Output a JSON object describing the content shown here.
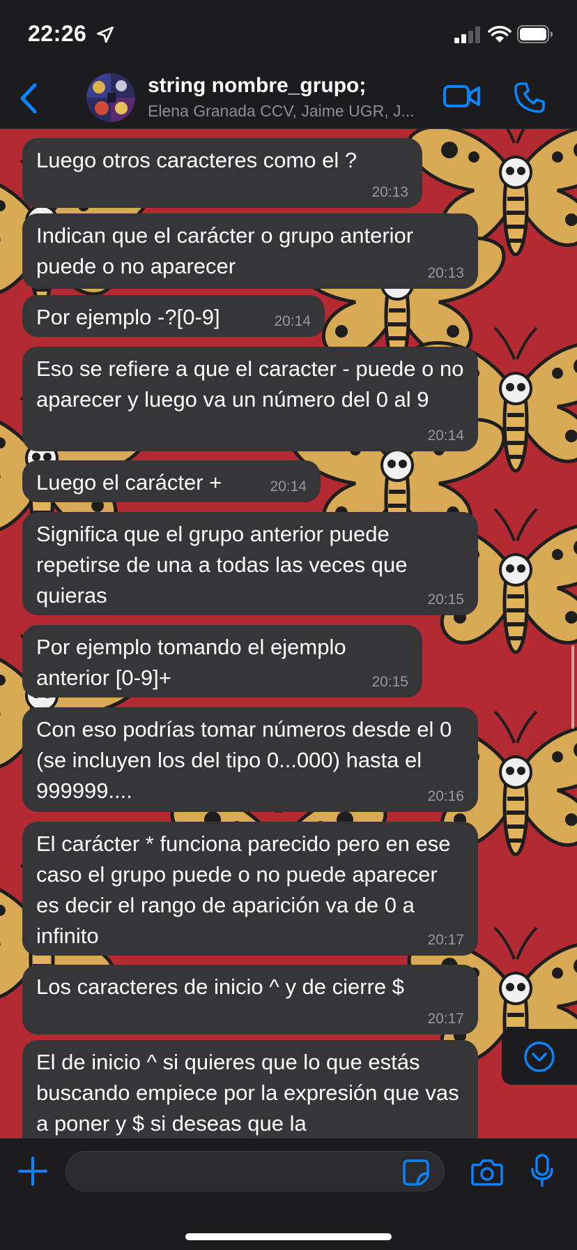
{
  "colors": {
    "accent": "#0a84ff",
    "bubble": "#363638",
    "wallpaper": "#b42a33",
    "bar": "#1c1c1e"
  },
  "status_bar": {
    "time": "22:26",
    "icons": [
      "location-arrow-icon",
      "signal-icon",
      "wifi-icon",
      "battery-icon"
    ]
  },
  "header": {
    "title": "string nombre_grupo;",
    "subtitle": "Elena Granada CCV, Jaime UGR, J...",
    "icons": [
      "back-chevron-icon",
      "group-avatar",
      "video-camera-icon",
      "phone-icon"
    ]
  },
  "messages": [
    {
      "text": "Luego otros caracteres como el ?",
      "time": "20:13"
    },
    {
      "text": "Indican que el carácter o grupo anterior puede o no aparecer",
      "time": "20:13"
    },
    {
      "text": "Por ejemplo -?[0-9]",
      "time": "20:14"
    },
    {
      "text": "Eso se refiere a que el caracter - puede o no aparecer y luego va un número del 0 al 9",
      "time": "20:14"
    },
    {
      "text": "Luego el carácter +",
      "time": "20:14"
    },
    {
      "text": "Significa que el grupo anterior puede repetirse de una a todas las veces que quieras",
      "time": "20:15"
    },
    {
      "text": "Por ejemplo tomando el ejemplo anterior [0-9]+",
      "time": "20:15"
    },
    {
      "text": "Con eso podrías tomar números desde el 0 (se incluyen los del tipo 0...000) hasta el 999999....",
      "time": "20:16"
    },
    {
      "text": "El carácter * funciona parecido pero en ese caso el grupo puede o no puede aparecer es decir el rango de aparición va de 0 a infinito",
      "time": "20:17"
    },
    {
      "text": "Los caracteres de inicio ^ y de cierre $",
      "time": "20:17"
    },
    {
      "text": "El de inicio ^ si quieres que lo que estás buscando empiece por la expresión que vas a poner y $ si deseas que la",
      "time": ""
    }
  ],
  "composer": {
    "input_value": "",
    "icons": [
      "plus-icon",
      "sticker-icon",
      "camera-icon",
      "microphone-icon"
    ]
  },
  "scroll_down_icon": "chevron-down-circle-icon"
}
